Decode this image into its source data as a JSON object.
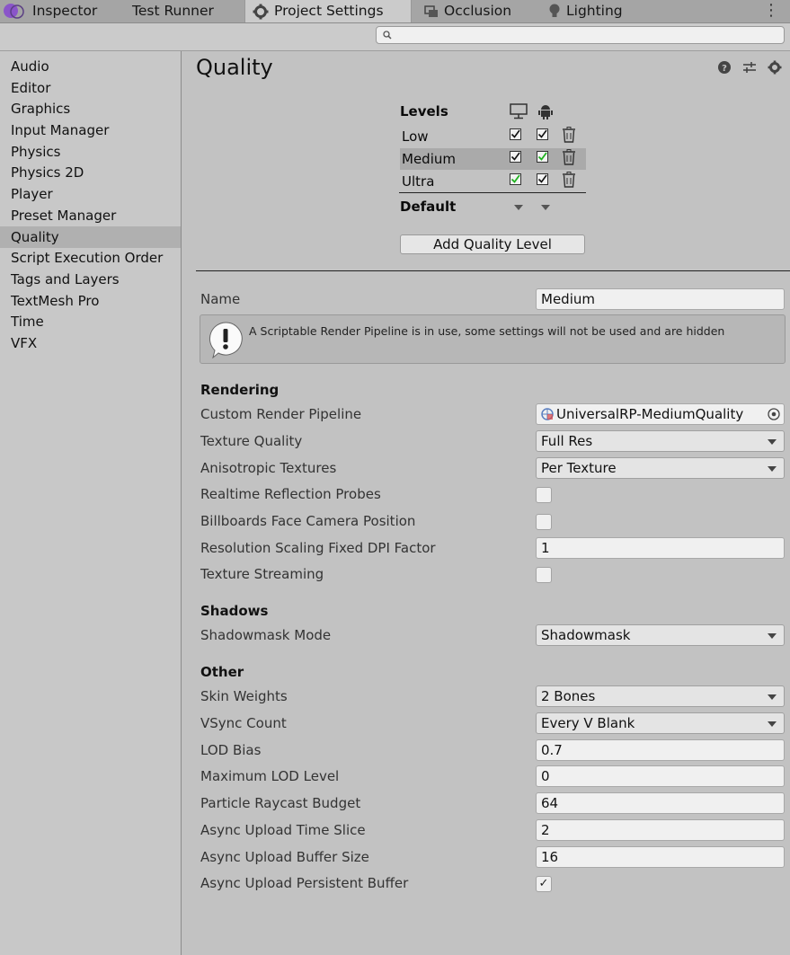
{
  "tabs": [
    {
      "label": "Inspector",
      "icon": "inspector-icon"
    },
    {
      "label": "Test Runner",
      "icon": ""
    },
    {
      "label": "Project Settings",
      "icon": "gear-icon",
      "active": true
    },
    {
      "label": "Occlusion",
      "icon": "occlusion-icon"
    },
    {
      "label": "Lighting",
      "icon": "lightbulb-icon"
    }
  ],
  "menu_glyph": "⋮",
  "sidebar": {
    "selected": "Quality",
    "items": [
      "Audio",
      "Editor",
      "Graphics",
      "Input Manager",
      "Physics",
      "Physics 2D",
      "Player",
      "Preset Manager",
      "Quality",
      "Script Execution Order",
      "Tags and Layers",
      "TextMesh Pro",
      "Time",
      "VFX"
    ]
  },
  "page": {
    "title": "Quality",
    "header_icons": [
      "help-icon",
      "presets-icon",
      "settings-gear-icon"
    ]
  },
  "levels": {
    "header": "Levels",
    "platform_icons": [
      "standalone-monitor-icon",
      "android-icon"
    ],
    "rows": [
      {
        "name": "Low",
        "standalone": true,
        "android": true,
        "standalone_default": false,
        "android_default": false,
        "selected": false
      },
      {
        "name": "Medium",
        "standalone": true,
        "android": true,
        "standalone_default": false,
        "android_default": true,
        "selected": true
      },
      {
        "name": "Ultra",
        "standalone": true,
        "android": true,
        "standalone_default": true,
        "android_default": false,
        "selected": false
      }
    ],
    "default_label": "Default",
    "add_button": "Add Quality Level"
  },
  "properties": {
    "name_label": "Name",
    "name_value": "Medium",
    "help_text": "A Scriptable Render Pipeline is in use, some settings will not be used and are hidden",
    "rendering": {
      "header": "Rendering",
      "custom_rp_label": "Custom Render Pipeline",
      "custom_rp_value": "UniversalRP-MediumQuality",
      "texture_quality_label": "Texture Quality",
      "texture_quality_value": "Full Res",
      "aniso_label": "Anisotropic Textures",
      "aniso_value": "Per Texture",
      "reflection_label": "Realtime Reflection Probes",
      "reflection_checked": false,
      "billboards_label": "Billboards Face Camera Position",
      "billboards_checked": false,
      "dpi_label": "Resolution Scaling Fixed DPI Factor",
      "dpi_value": "1",
      "streaming_label": "Texture Streaming",
      "streaming_checked": false
    },
    "shadows": {
      "header": "Shadows",
      "shadowmask_label": "Shadowmask Mode",
      "shadowmask_value": "Shadowmask"
    },
    "other": {
      "header": "Other",
      "skin_label": "Skin Weights",
      "skin_value": "2 Bones",
      "vsync_label": "VSync Count",
      "vsync_value": "Every V Blank",
      "lod_bias_label": "LOD Bias",
      "lod_bias_value": "0.7",
      "max_lod_label": "Maximum LOD Level",
      "max_lod_value": "0",
      "raycast_label": "Particle Raycast Budget",
      "raycast_value": "64",
      "slice_label": "Async Upload Time Slice",
      "slice_value": "2",
      "buffer_label": "Async Upload Buffer Size",
      "buffer_value": "16",
      "persistent_label": "Async Upload Persistent Buffer",
      "persistent_checked": true,
      "check_glyph": "✓"
    }
  },
  "colors": {
    "default_check": "#1fb31f",
    "selected_row": "#aaaaaa",
    "panel": "#c2c2c2"
  }
}
